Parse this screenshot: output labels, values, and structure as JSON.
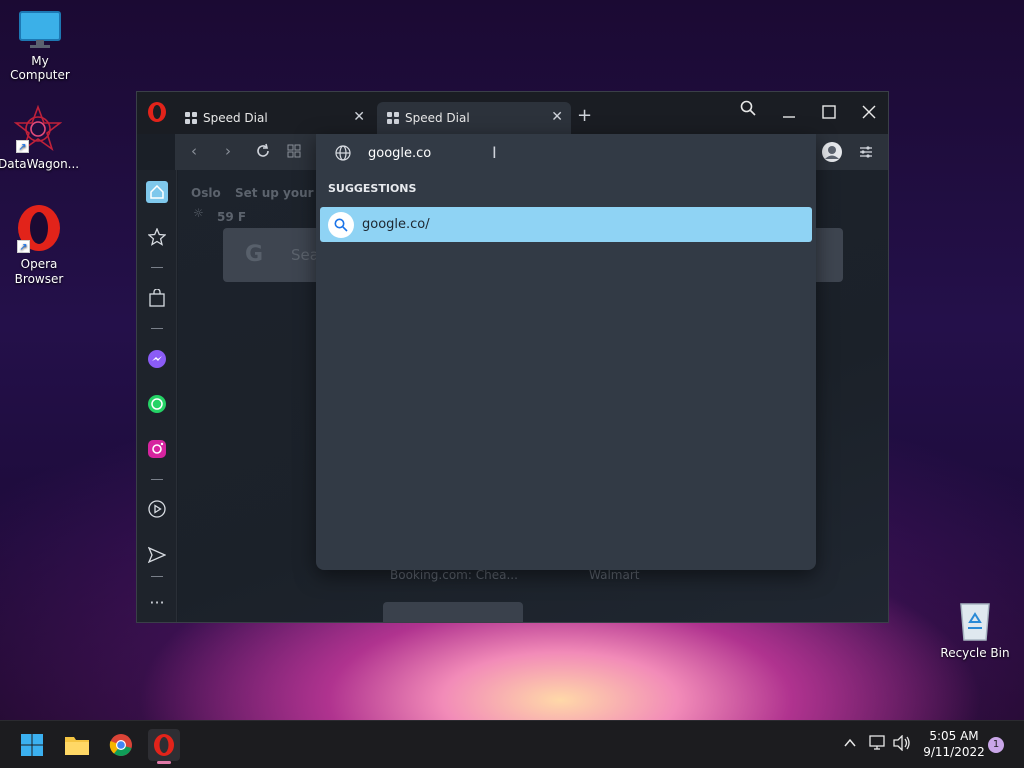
{
  "desktop": {
    "icons": [
      {
        "label": "My Computer"
      },
      {
        "label": "DataWagon..."
      },
      {
        "label": "Opera\nBrowser"
      },
      {
        "label": "Recycle Bin"
      }
    ]
  },
  "browser": {
    "tabs": [
      {
        "label": "Speed Dial"
      },
      {
        "label": "Speed Dial"
      }
    ],
    "address": {
      "value": "google.co"
    },
    "suggestions": {
      "header": "SUGGESTIONS",
      "items": [
        {
          "text": "google.co/"
        }
      ]
    },
    "background": {
      "city": "Oslo",
      "setup_text": "Set up your ci",
      "weather": "59 F",
      "search_partial": "Sea",
      "tiles": [
        "Booking.com: Chea...",
        "Walmart"
      ]
    }
  },
  "taskbar": {
    "time": "5:05 AM",
    "date": "9/11/2022",
    "notification_count": "1"
  },
  "colors": {
    "accent": "#8fd3f4",
    "opera_red": "#e2231a",
    "window_bg": "#1a1f27",
    "dropdown_bg": "#323a45"
  }
}
